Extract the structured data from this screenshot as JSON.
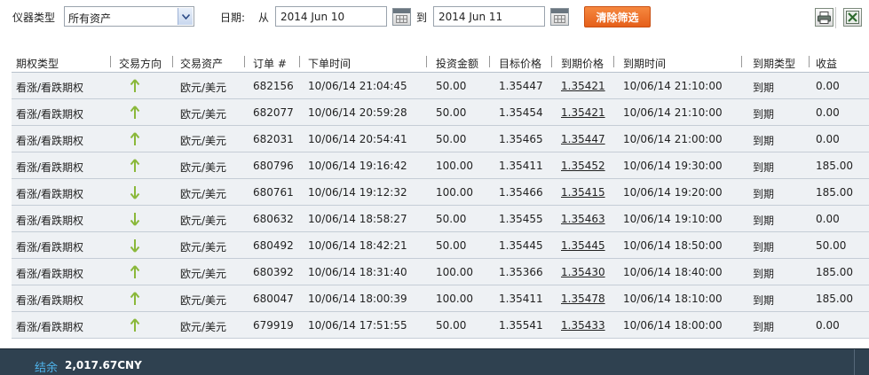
{
  "filter": {
    "instrument_label": "仪器类型",
    "instrument_value": "所有资产",
    "date_label": "日期:",
    "from_label": "从",
    "from_value": "2014 Jun 10",
    "to_label": "到",
    "to_value": "2014 Jun 11",
    "clear_label": "清除筛选"
  },
  "table": {
    "headers": [
      "期权类型",
      "交易方向",
      "交易资产",
      "订单 #",
      "下单时间",
      "投资金额",
      "目标价格",
      "到期价格",
      "到期时间",
      "到期类型",
      "收益"
    ],
    "rows": [
      {
        "type": "看涨/看跌期权",
        "direction": "up",
        "asset": "欧元/美元",
        "order": "682156",
        "time": "10/06/14 21:04:45",
        "amount": "50.00",
        "target": "1.35447",
        "expiry_price": "1.35421",
        "expiry_time": "10/06/14 21:10:00",
        "expiry_type": "到期",
        "payout": "0.00"
      },
      {
        "type": "看涨/看跌期权",
        "direction": "up",
        "asset": "欧元/美元",
        "order": "682077",
        "time": "10/06/14 20:59:28",
        "amount": "50.00",
        "target": "1.35454",
        "expiry_price": "1.35421",
        "expiry_time": "10/06/14 21:10:00",
        "expiry_type": "到期",
        "payout": "0.00"
      },
      {
        "type": "看涨/看跌期权",
        "direction": "up",
        "asset": "欧元/美元",
        "order": "682031",
        "time": "10/06/14 20:54:41",
        "amount": "50.00",
        "target": "1.35465",
        "expiry_price": "1.35447",
        "expiry_time": "10/06/14 21:00:00",
        "expiry_type": "到期",
        "payout": "0.00"
      },
      {
        "type": "看涨/看跌期权",
        "direction": "up",
        "asset": "欧元/美元",
        "order": "680796",
        "time": "10/06/14 19:16:42",
        "amount": "100.00",
        "target": "1.35411",
        "expiry_price": "1.35452",
        "expiry_time": "10/06/14 19:30:00",
        "expiry_type": "到期",
        "payout": "185.00"
      },
      {
        "type": "看涨/看跌期权",
        "direction": "down",
        "asset": "欧元/美元",
        "order": "680761",
        "time": "10/06/14 19:12:32",
        "amount": "100.00",
        "target": "1.35466",
        "expiry_price": "1.35415",
        "expiry_time": "10/06/14 19:20:00",
        "expiry_type": "到期",
        "payout": "185.00"
      },
      {
        "type": "看涨/看跌期权",
        "direction": "down",
        "asset": "欧元/美元",
        "order": "680632",
        "time": "10/06/14 18:58:27",
        "amount": "50.00",
        "target": "1.35455",
        "expiry_price": "1.35463",
        "expiry_time": "10/06/14 19:10:00",
        "expiry_type": "到期",
        "payout": "0.00"
      },
      {
        "type": "看涨/看跌期权",
        "direction": "down",
        "asset": "欧元/美元",
        "order": "680492",
        "time": "10/06/14 18:42:21",
        "amount": "50.00",
        "target": "1.35445",
        "expiry_price": "1.35445",
        "expiry_time": "10/06/14 18:50:00",
        "expiry_type": "到期",
        "payout": "50.00"
      },
      {
        "type": "看涨/看跌期权",
        "direction": "up",
        "asset": "欧元/美元",
        "order": "680392",
        "time": "10/06/14 18:31:40",
        "amount": "100.00",
        "target": "1.35366",
        "expiry_price": "1.35430",
        "expiry_time": "10/06/14 18:40:00",
        "expiry_type": "到期",
        "payout": "185.00"
      },
      {
        "type": "看涨/看跌期权",
        "direction": "up",
        "asset": "欧元/美元",
        "order": "680047",
        "time": "10/06/14 18:00:39",
        "amount": "100.00",
        "target": "1.35411",
        "expiry_price": "1.35478",
        "expiry_time": "10/06/14 18:10:00",
        "expiry_type": "到期",
        "payout": "185.00"
      },
      {
        "type": "看涨/看跌期权",
        "direction": "up",
        "asset": "欧元/美元",
        "order": "679919",
        "time": "10/06/14 17:51:55",
        "amount": "50.00",
        "target": "1.35541",
        "expiry_price": "1.35433",
        "expiry_time": "10/06/14 18:00:00",
        "expiry_type": "到期",
        "payout": "0.00"
      }
    ]
  },
  "footer": {
    "balance_label": "结余",
    "balance_value": "2,017.67CNY"
  },
  "icons": {
    "print": "print-icon",
    "export": "excel-export-icon",
    "calendar": "calendar-icon",
    "up_arrow": "arrow-up-icon",
    "down_arrow": "arrow-down-icon"
  },
  "colors": {
    "clear_button": "#ee7430",
    "direction_arrow": "#8ab83a",
    "row_bg": "#eef1f4",
    "footer_bg": "#2f4150",
    "footer_label": "#4fb4ec"
  }
}
